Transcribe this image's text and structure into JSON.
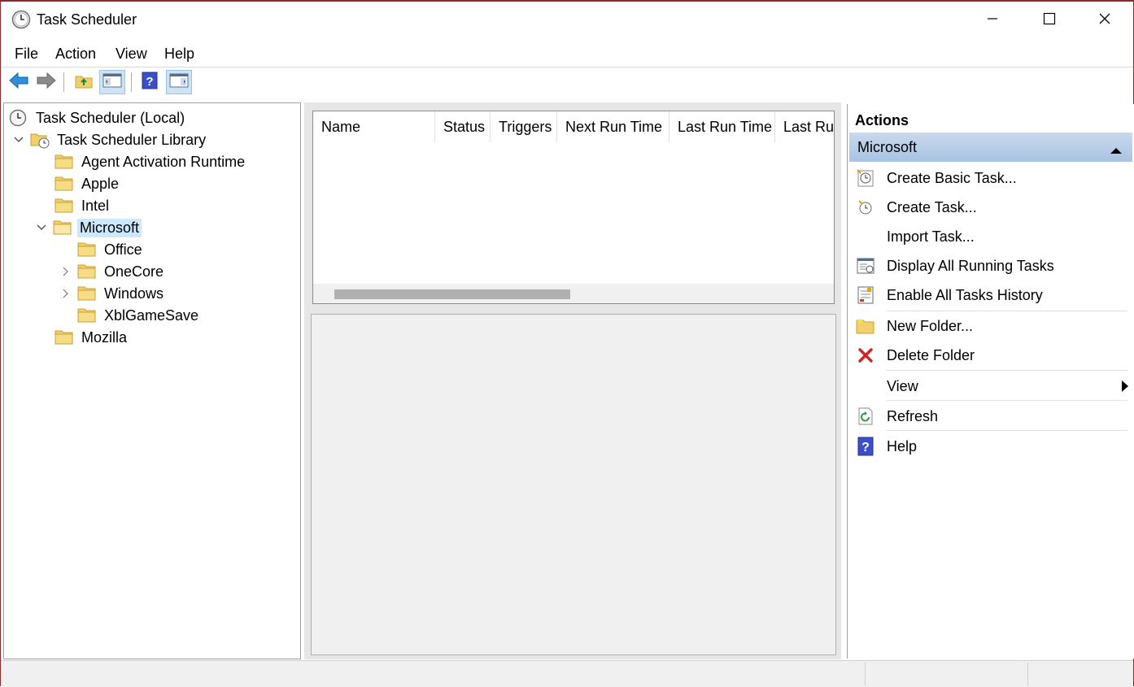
{
  "window": {
    "title": "Task Scheduler"
  },
  "menu": [
    "File",
    "Action",
    "View",
    "Help"
  ],
  "toolbar": {
    "buttons": [
      "back-arrow-icon",
      "forward-arrow-icon",
      "folder-up-icon",
      "show-hide-tree-icon",
      "help-icon",
      "show-hide-action-pane-icon"
    ]
  },
  "tree": {
    "root": "Task Scheduler (Local)",
    "library": "Task Scheduler Library",
    "items": [
      {
        "label": "Agent Activation Runtime"
      },
      {
        "label": "Apple"
      },
      {
        "label": "Intel"
      },
      {
        "label": "Microsoft",
        "selected": true
      },
      {
        "label": "Office"
      },
      {
        "label": "OneCore"
      },
      {
        "label": "Windows"
      },
      {
        "label": "XblGameSave"
      },
      {
        "label": "Mozilla"
      }
    ]
  },
  "task_list": {
    "columns": [
      "Name",
      "Status",
      "Triggers",
      "Next Run Time",
      "Last Run Time",
      "Last Run Result"
    ]
  },
  "actions": {
    "title": "Actions",
    "section": "Microsoft",
    "items": [
      {
        "label": "Create Basic Task...",
        "icon": "create-basic-task-icon"
      },
      {
        "label": "Create Task...",
        "icon": "create-task-icon"
      },
      {
        "label": "Import Task...",
        "icon": ""
      },
      {
        "label": "Display All Running Tasks",
        "icon": "running-tasks-icon"
      },
      {
        "label": "Enable All Tasks History",
        "icon": "history-icon"
      },
      {
        "label": "New Folder...",
        "icon": "new-folder-icon"
      },
      {
        "label": "Delete Folder",
        "icon": "delete-icon"
      },
      {
        "label": "View",
        "icon": ""
      },
      {
        "label": "Refresh",
        "icon": "refresh-icon"
      },
      {
        "label": "Help",
        "icon": "help-icon"
      }
    ]
  },
  "colors": {
    "selection": "#cce8ff",
    "section_header": "#b8cfe8",
    "accent": "#2a7fd4"
  }
}
